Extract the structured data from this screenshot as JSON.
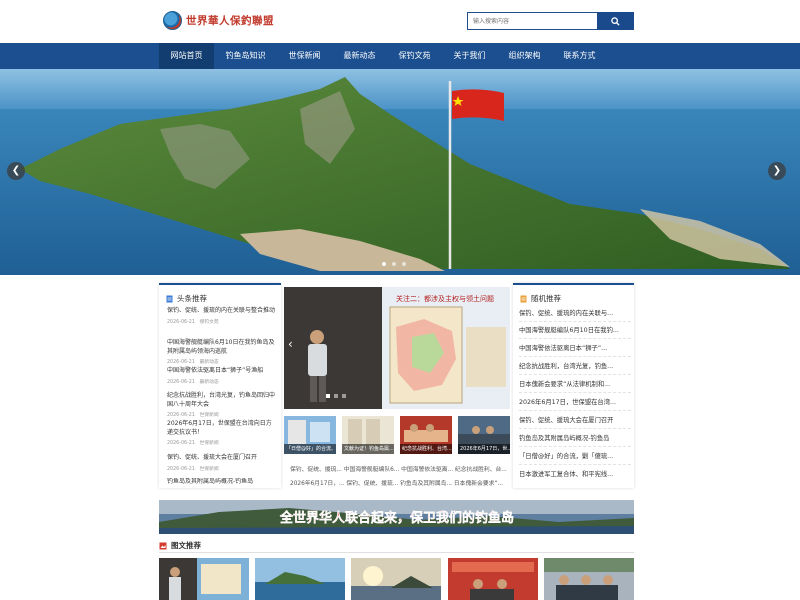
{
  "site": {
    "name": "世界華人保釣聯盟"
  },
  "search": {
    "placeholder": "输入搜索内容"
  },
  "nav": {
    "items": [
      {
        "label": "网站首页"
      },
      {
        "label": "钓鱼岛知识"
      },
      {
        "label": "世保新闻"
      },
      {
        "label": "最新动态"
      },
      {
        "label": "保钓文苑"
      },
      {
        "label": "关于我们"
      },
      {
        "label": "组织架构"
      },
      {
        "label": "联系方式"
      }
    ]
  },
  "headlines": {
    "title": "头条推荐",
    "items": [
      {
        "title": "保钓、促统、援琉的内在关联与整合推动",
        "date": "2026-06-21",
        "category": "保钓文苑"
      },
      {
        "title": "中国海警舰艇编队6月10日在我钓鱼岛及其附属岛屿领海内巡航",
        "date": "2026-06-21",
        "category": "最新动态"
      },
      {
        "title": "中国海警依法驱离日本“狮子”号渔船",
        "date": "2026-06-21",
        "category": "最新动态"
      },
      {
        "title": "纪念抗战胜利，台湾光复，钓鱼岛回归中国八十周年大会",
        "date": "2026-06-21",
        "category": "世保新闻"
      },
      {
        "title": "2026年6月17日，世保盟在台湾向日方递交抗议书！",
        "date": "2026-06-21",
        "category": "世保新闻"
      },
      {
        "title": "保钓、促统、援琉大会在厦门召开",
        "date": "2026-06-21",
        "category": "世保新闻"
      },
      {
        "title": "钓鱼岛及其附属岛屿概况-钓鱼岛",
        "date": "",
        "category": ""
      }
    ]
  },
  "slide": {
    "slide_text": "关注二：都涉及主权与领土问题",
    "thumbs": [
      {
        "caption": "「日僧@好」的合流、对..."
      },
      {
        "caption": "文献为证！钓鱼岛属..."
      },
      {
        "caption": "纪念抗战胜利、台湾..."
      },
      {
        "caption": "2026年6月17日，世..."
      }
    ],
    "ticker_line1": "保钓、促统、援琉...  中国海警舰艇编队6...  中国海警依法驱离...  纪念抗战胜利、台...",
    "ticker_line2": "2026年6月17日，...  保钓、促统、援琉...  钓鱼岛及其附属岛...  日本傀新会要求“..."
  },
  "random": {
    "title": "随机推荐",
    "items": [
      {
        "title": "保钓、促统、援琉的内在关联与..."
      },
      {
        "title": "中国海警舰艇编队6月10日在我钓..."
      },
      {
        "title": "中国海警依法驱离日本“狮子”..."
      },
      {
        "title": "纪念抗战胜利，台湾光复，钓鱼..."
      },
      {
        "title": "日本傀新会要求“从法律机制和..."
      },
      {
        "title": "2026年6月17日，世保盟在台湾..."
      },
      {
        "title": "保钓、促统、援琉大会在厦门召开"
      },
      {
        "title": "钓鱼岛及其附属岛屿概况-钓鱼岛"
      },
      {
        "title": "「日僧@好」的合流，剿「傻琉..."
      },
      {
        "title": "日本激进军工复合体、和平宪线..."
      }
    ]
  },
  "slogan": {
    "text": "全世界华人联合起来，保卫我们的钓鱼岛"
  },
  "photo_section": {
    "title": "图文推荐"
  },
  "colors": {
    "primary": "#1b4f8f",
    "nav_active": "#123d70",
    "brand_red": "#c0392b"
  },
  "icons": {
    "search": "search-icon",
    "prev": "chevron-left-icon",
    "next": "chevron-right-icon"
  }
}
